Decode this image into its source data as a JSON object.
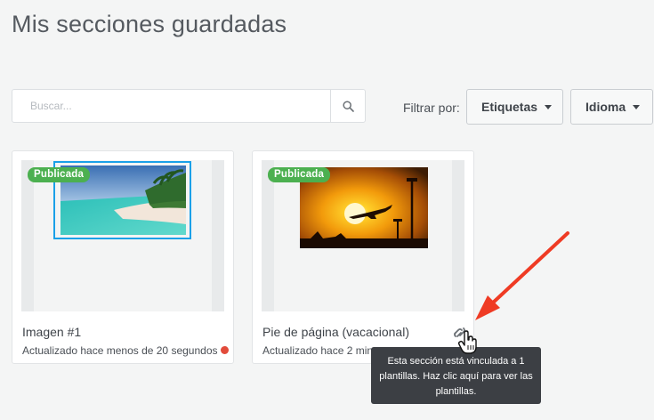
{
  "page": {
    "title": "Mis secciones guardadas"
  },
  "search": {
    "placeholder": "Buscar..."
  },
  "filters": {
    "label": "Filtrar por:",
    "tags_label": "Etiquetas",
    "language_label": "Idioma"
  },
  "cards": [
    {
      "badge": "Publicada",
      "title": "Imagen #1",
      "updated": "Actualizado hace menos de 20 segundos",
      "status_color": "#e24b3b"
    },
    {
      "badge": "Publicada",
      "title": "Pie de página (vacacional)",
      "updated": "Actualizado hace 2 minutos"
    }
  ],
  "tooltip": {
    "text": "Esta sección está vinculada a  1 plantillas. Haz clic aquí para ver las plantillas."
  },
  "colors": {
    "badge_green": "#4cb050",
    "selection_blue": "#1aa0e8",
    "annotation_red": "#ef3b24",
    "tooltip_bg": "#3c3f44"
  },
  "icons": {
    "search": "search-icon",
    "linked_templates": "link-icon",
    "pointer": "hand-pointer-icon"
  }
}
